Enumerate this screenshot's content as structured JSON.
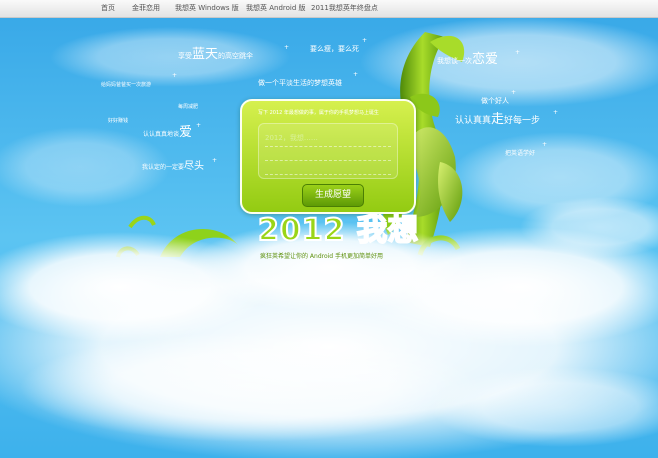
{
  "nav": {
    "items": [
      "首页",
      "金菲恋用",
      "我想英 Windows 版",
      "我想英 Android 版",
      "2011我想英年终盘点"
    ]
  },
  "words": [
    {
      "pre": "享受",
      "big": "蓝天",
      "post": "的高空跳伞"
    },
    {
      "pre": "要么瘦",
      "big": "",
      "post": "，要么死"
    },
    {
      "pre": "我想谈一次",
      "big": "恋爱",
      "post": ""
    },
    {
      "pre": "给妈妈爸爸",
      "big": "",
      "post": "买一次旅游"
    },
    {
      "pre": "做一个平淡生活的梦想英雄",
      "big": "",
      "post": ""
    },
    {
      "pre": "做个好人",
      "big": "",
      "post": ""
    },
    {
      "pre": "每周减肥",
      "big": "",
      "post": ""
    },
    {
      "pre": "好好赚钱",
      "big": "",
      "post": ""
    },
    {
      "pre": "认认真真地谈",
      "big": "爱",
      "post": ""
    },
    {
      "pre": "认认真真",
      "big": "走",
      "post": "好每一步"
    },
    {
      "pre": "把英语学好",
      "big": "",
      "post": ""
    },
    {
      "pre": "我认定的一定要",
      "big": "尽头",
      "post": ""
    }
  ],
  "card": {
    "hint": "写下 2012 年最想做的事，属于你的手机梦想马上诞生",
    "placeholder": "2012，我想……",
    "button": "生成愿望"
  },
  "title": "2012 我想",
  "subtitle": "疯狂英希望让你的 Android 手机更加简单好用",
  "colors": {
    "sky": "#3fb3ec",
    "cloud": "#ffffff",
    "green": "#9ad518",
    "dark_green": "#4f8a0a"
  }
}
